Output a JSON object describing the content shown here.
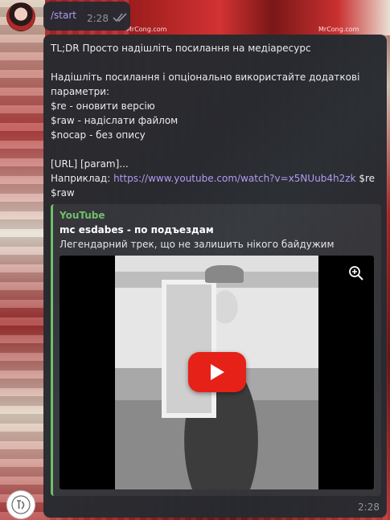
{
  "wallpaper": {
    "watermark_1": "MrCong.com",
    "watermark_2": "MrCong.com"
  },
  "outgoing_message": {
    "text": "/start",
    "time": "2:28",
    "status_icon": "double-check-icon"
  },
  "bot_message": {
    "lines": [
      "TL;DR Просто надішліть посилання на медіаресурс",
      "",
      "Надішліть посилання і опціонально використайте додаткові",
      "параметри:",
      "$re - оновити версію",
      "$raw - надіслати файлом",
      "$nocap - без опису",
      "",
      "[URL] [param]..."
    ],
    "example_label": "Наприклад: ",
    "example_link": "https://www.youtube.com/watch?v=x5NUub4h2zk",
    "example_suffix": " $re",
    "example_suffix2": "$raw",
    "time": "2:28",
    "preview": {
      "site": "YouTube",
      "title": "mc esdabes - по подъездам",
      "description": "Легендарний трек, що не залишить нікого байдужим",
      "zoom_icon": "zoom-in-icon",
      "play_icon": "play-icon"
    }
  },
  "colors": {
    "bubble": "#262a30",
    "accent_link": "#b19bf3",
    "preview_bar": "#6fbf6a",
    "youtube_red": "#e62117"
  }
}
